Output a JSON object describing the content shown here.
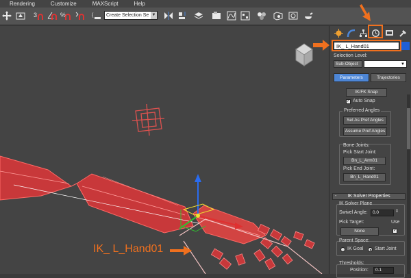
{
  "menu": [
    "Rendering",
    "Customize",
    "MAXScript",
    "Help"
  ],
  "toolbar": {
    "selection_set_placeholder": "Create Selection Se",
    "icons": [
      "move-icon",
      "snap-3-icon",
      "angle-snap-icon",
      "percent-snap-icon",
      "spinner-snap-icon",
      "edit-named-sets-icon",
      "mirror-icon",
      "align-icon",
      "layer-icon",
      "graphite-icon",
      "curve-editor-icon",
      "schematic-view-icon",
      "material-editor-icon",
      "render-setup-icon",
      "rendered-frame-icon",
      "render-icon"
    ]
  },
  "panel": {
    "tabs": [
      "create-tab",
      "modify-tab",
      "hierarchy-tab",
      "motion-tab",
      "display-tab",
      "utilities-tab"
    ],
    "object_name": "IK_ L_Hand01",
    "selection_level_label": "Selection Level:",
    "selection_level_value": "Sub-Object",
    "tab_parameters": "Parameters",
    "tab_trajectories": "Trajectories",
    "ikfk_snap": "IK/FK Snap",
    "auto_snap": "Auto Snap",
    "preferred_angles_title": "Preferred Angles",
    "set_as_pref": "Set As Pref Angles",
    "assume_pref": "Assume Pref Angles",
    "bone_joints_title": "Bone Joints:",
    "pick_start_label": "Pick Start Joint:",
    "start_joint": "Bn_L_Arm01",
    "pick_end_label": "Pick End Joint:",
    "end_joint": "Bn_L_Hand01",
    "ik_solver_props": "IK Solver Properties",
    "ik_solver_plane": "IK Solver Plane",
    "swivel_label": "Swivel Angle:",
    "swivel_value": "0.0",
    "pick_target_label": "Pick Target:",
    "use_label": "Use",
    "none_button": "None",
    "parent_space_title": "Parent Space:",
    "ik_goal": "IK Goal",
    "start_joint_radio": "Start Joint",
    "thresholds_title": "Thresholds:",
    "position_label": "Position:",
    "position_value": "0.1"
  },
  "annotation": {
    "label": "IK_ L_Hand01"
  },
  "colors": {
    "accent": "#f0701e",
    "bone": "#e0524f",
    "selection": "#4d86d6"
  }
}
